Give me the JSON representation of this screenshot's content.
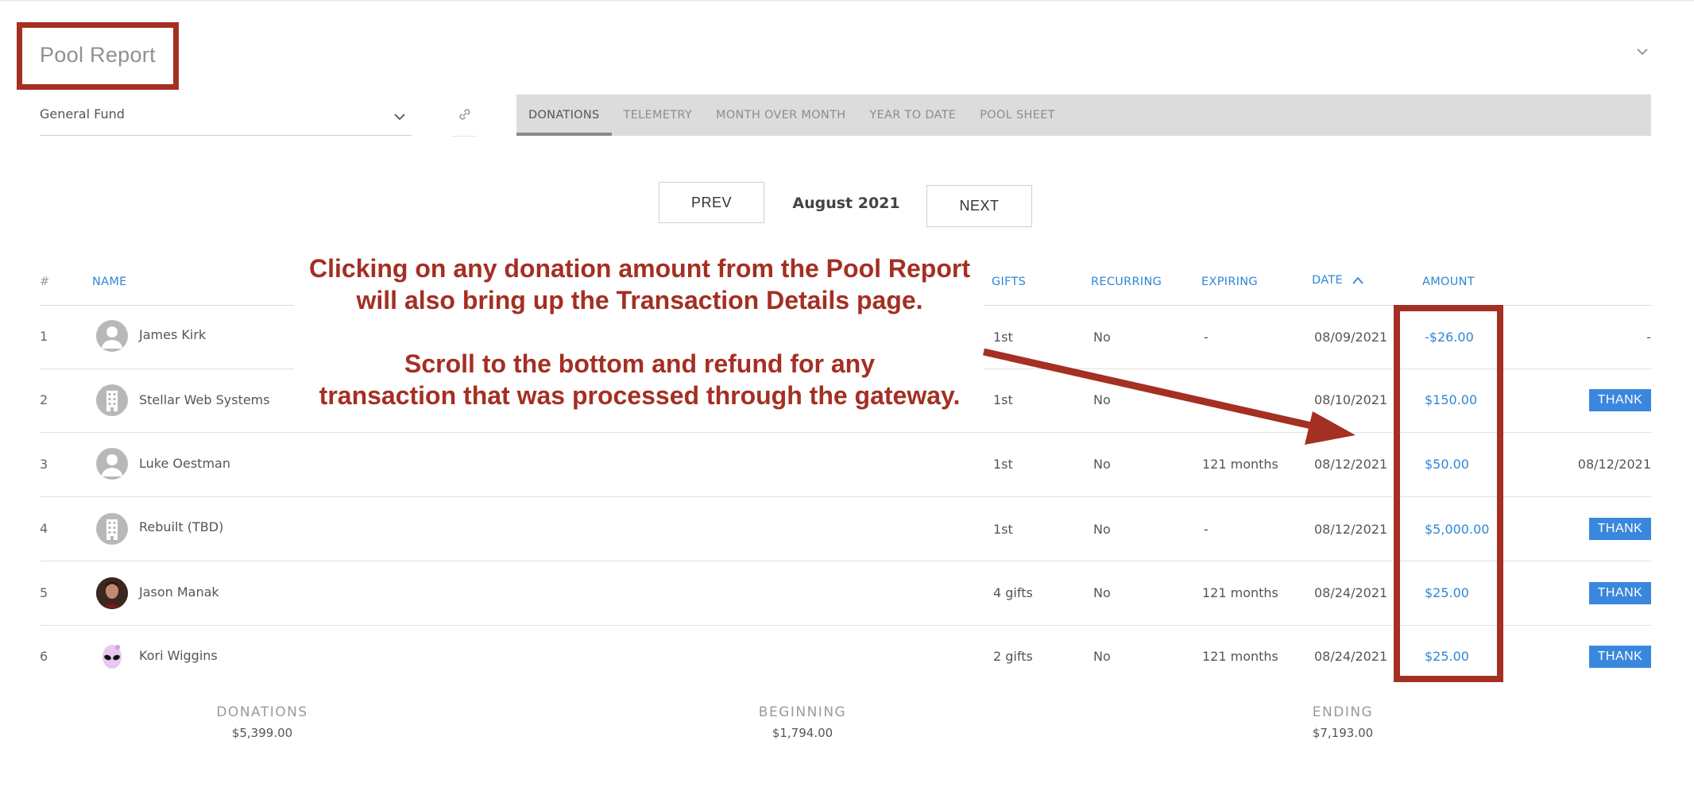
{
  "page": {
    "title": "Pool Report"
  },
  "fund_select": {
    "value": "General Fund"
  },
  "tabs": [
    {
      "label": "DONATIONS",
      "active": true
    },
    {
      "label": "TELEMETRY",
      "active": false
    },
    {
      "label": "MONTH OVER MONTH",
      "active": false
    },
    {
      "label": "YEAR TO DATE",
      "active": false
    },
    {
      "label": "POOL SHEET",
      "active": false
    }
  ],
  "pager": {
    "prev_label": "PREV",
    "month": "August 2021",
    "next_label": "NEXT"
  },
  "table": {
    "headers": {
      "num": "#",
      "name": "NAME",
      "gifts": "GIFTS",
      "recurring": "RECURRING",
      "expiring": "EXPIRING",
      "date": "DATE",
      "amount": "AMOUNT"
    },
    "sort": {
      "column": "date",
      "direction": "asc"
    },
    "rows": [
      {
        "index": "1",
        "name": "James Kirk",
        "avatar": "person-icon",
        "gifts": "1st",
        "recurring": "No",
        "expiring": "-",
        "date": "08/09/2021",
        "amount": "-$26.00",
        "action": "-"
      },
      {
        "index": "2",
        "name": "Stellar Web Systems",
        "avatar": "building-icon",
        "gifts": "1st",
        "recurring": "No",
        "expiring": "",
        "date": "08/10/2021",
        "amount": "$150.00",
        "action": "THANK"
      },
      {
        "index": "3",
        "name": "Luke Oestman",
        "avatar": "person-icon",
        "gifts": "1st",
        "recurring": "No",
        "expiring": "121 months",
        "date": "08/12/2021",
        "amount": "$50.00",
        "action": "08/12/2021"
      },
      {
        "index": "4",
        "name": "Rebuilt (TBD)",
        "avatar": "building-icon",
        "gifts": "1st",
        "recurring": "No",
        "expiring": "-",
        "date": "08/12/2021",
        "amount": "$5,000.00",
        "action": "THANK"
      },
      {
        "index": "5",
        "name": "Jason Manak",
        "avatar": "photo-avatar",
        "gifts": "4 gifts",
        "recurring": "No",
        "expiring": "121 months",
        "date": "08/24/2021",
        "amount": "$25.00",
        "action": "THANK"
      },
      {
        "index": "6",
        "name": "Kori Wiggins",
        "avatar": "alien-avatar",
        "gifts": "2 gifts",
        "recurring": "No",
        "expiring": "121 months",
        "date": "08/24/2021",
        "amount": "$25.00",
        "action": "THANK"
      }
    ]
  },
  "summary": {
    "donations_label": "DONATIONS",
    "donations_value": "$5,399.00",
    "beginning_label": "BEGINNING",
    "beginning_value": "$1,794.00",
    "ending_label": "ENDING",
    "ending_value": "$7,193.00"
  },
  "annotation": {
    "line1": "Clicking on any donation amount from the Pool Report",
    "line2": "will also bring up the Transaction Details page.",
    "line3": "Scroll to the bottom and refund for any",
    "line4": "transaction that was processed through the gateway."
  },
  "colors": {
    "accent": "#2f86d8",
    "annotation": "#a42f23",
    "thank_button": "#3a87de"
  }
}
